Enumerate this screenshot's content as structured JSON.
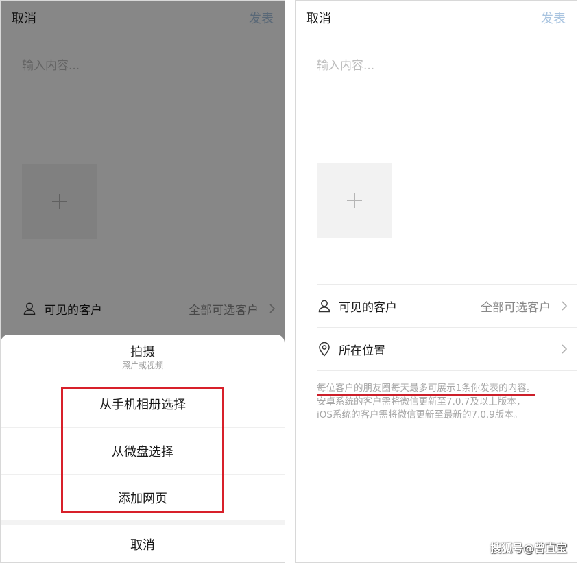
{
  "left_screen": {
    "topbar": {
      "cancel": "取消",
      "publish": "发表"
    },
    "input_placeholder": "输入内容...",
    "visible_customers": {
      "label": "可见的客户",
      "value": "全部可选客户"
    },
    "action_sheet": {
      "title": "拍摄",
      "subtitle": "照片或视频",
      "options": [
        "从手机相册选择",
        "从微盘选择",
        "添加网页"
      ],
      "cancel": "取消"
    }
  },
  "right_screen": {
    "topbar": {
      "cancel": "取消",
      "publish": "发表"
    },
    "input_placeholder": "输入内容...",
    "visible_customers": {
      "label": "可见的客户",
      "value": "全部可选客户"
    },
    "location": {
      "label": "所在位置"
    },
    "note": {
      "highlight": "每位客户的朋友圈每天最多可展示1条你发表的内容。",
      "line2": "安卓系统的客户需将微信更新至7.0.7及以上版本，",
      "line3": "iOS系统的客户需将微信更新至最新的7.0.9版本。"
    }
  },
  "watermark": "搜狐号@曾直宝",
  "colors": {
    "publish_disabled": "#a9c4e0",
    "highlight_red": "#d8202a",
    "placeholder": "#bdbdbd"
  },
  "icons": [
    "plus-icon",
    "person-icon",
    "location-pin-icon",
    "chevron-right-icon"
  ]
}
